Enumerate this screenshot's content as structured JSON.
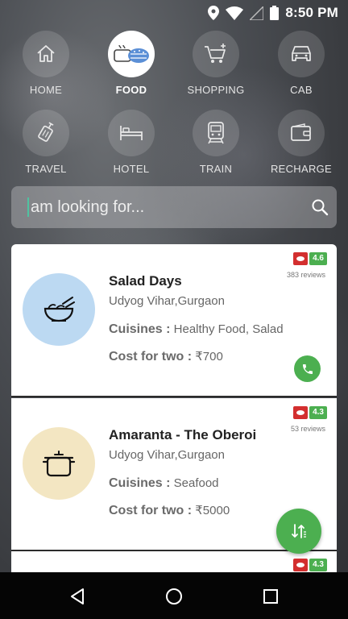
{
  "status": {
    "time": "8:50 PM"
  },
  "categories": [
    {
      "label": "HOME",
      "icon": "home-icon"
    },
    {
      "label": "FOOD",
      "icon": "food-icon",
      "active": true
    },
    {
      "label": "SHOPPING",
      "icon": "shopping-cart-icon"
    },
    {
      "label": "CAB",
      "icon": "car-icon"
    },
    {
      "label": "TRAVEL",
      "icon": "luggage-icon"
    },
    {
      "label": "HOTEL",
      "icon": "bed-icon"
    },
    {
      "label": "TRAIN",
      "icon": "train-icon"
    },
    {
      "label": "RECHARGE",
      "icon": "wallet-icon"
    }
  ],
  "search": {
    "placeholder": "am looking for..."
  },
  "restaurants": [
    {
      "name": "Salad Days",
      "location": "Udyog Vihar,Gurgaon",
      "cuisines_label": "Cuisines :",
      "cuisines": "Healthy Food, Salad",
      "cost_label": "Cost for two :",
      "cost": "₹700",
      "rating": "4.6",
      "reviews": "383 reviews",
      "thumb_color": "#bcd9f2",
      "icon": "bowl-icon"
    },
    {
      "name": "Amaranta - The Oberoi",
      "location": "Udyog Vihar,Gurgaon",
      "cuisines_label": "Cuisines :",
      "cuisines": "Seafood",
      "cost_label": "Cost for two :",
      "cost": "₹5000",
      "rating": "4.3",
      "reviews": "53 reviews",
      "thumb_color": "#f3e6c2",
      "icon": "cooking-pot-icon"
    }
  ],
  "partial_card": {
    "rating": "4.3"
  },
  "colors": {
    "accent": "#4caf50",
    "rating_logo": "#d32f2f"
  }
}
